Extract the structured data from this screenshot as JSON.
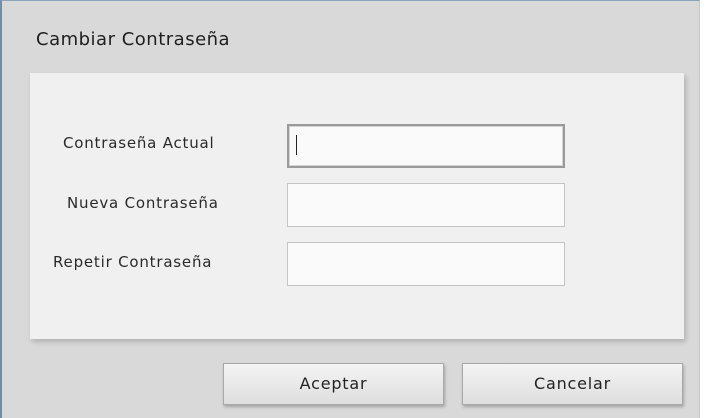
{
  "dialog": {
    "title": "Cambiar Contraseña"
  },
  "form": {
    "fields": [
      {
        "label": "Contraseña Actual",
        "value": ""
      },
      {
        "label": "Nueva Contraseña",
        "value": ""
      },
      {
        "label": "Repetir Contraseña",
        "value": ""
      }
    ]
  },
  "buttons": {
    "accept_label": "Aceptar",
    "cancel_label": "Cancelar"
  }
}
